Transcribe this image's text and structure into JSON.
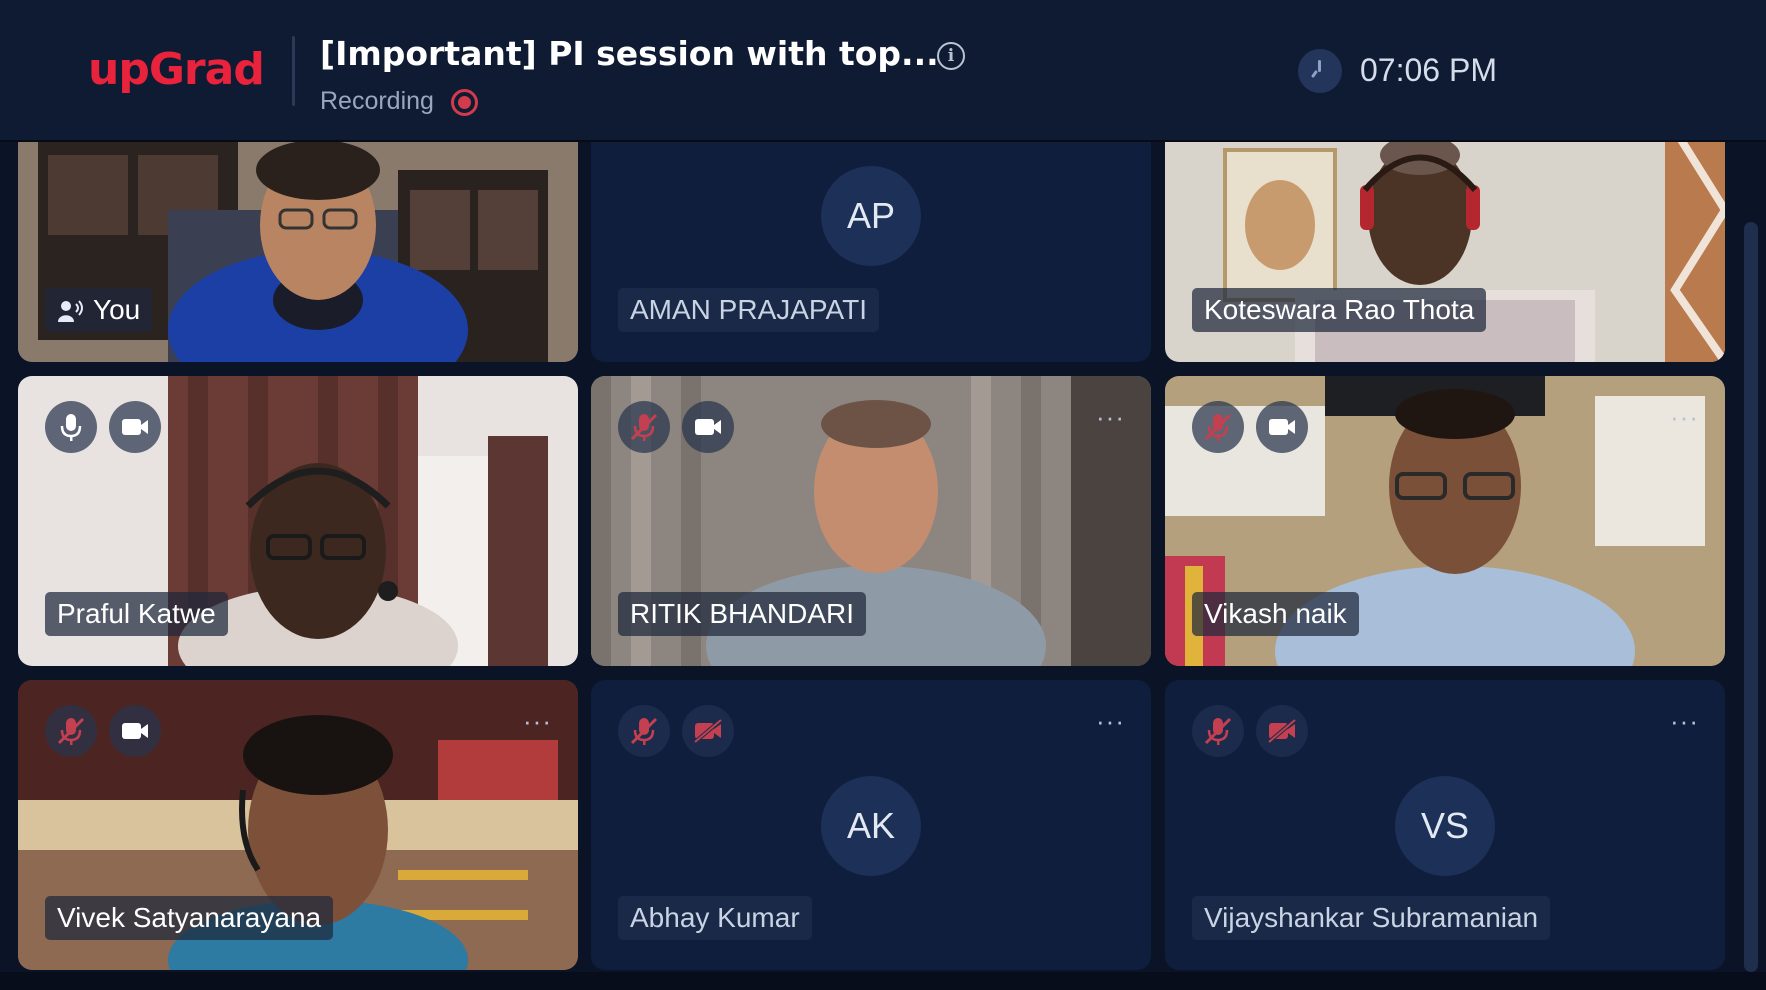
{
  "header": {
    "logo": "upGrad",
    "title": "[Important] PI session with top...",
    "recording_label": "Recording",
    "clock_time": "07:06 PM",
    "icons": [
      "info-icon",
      "recording-icon",
      "clock-icon"
    ]
  },
  "participants": [
    {
      "name": "You",
      "initials": "",
      "video": true,
      "mic": null,
      "cam": null,
      "speaking": true
    },
    {
      "name": "AMAN PRAJAPATI",
      "initials": "AP",
      "video": false
    },
    {
      "name": "Koteswara Rao Thota",
      "initials": "",
      "video": true
    },
    {
      "name": "Praful Katwe",
      "initials": "",
      "video": true,
      "mic": "on",
      "cam": "on"
    },
    {
      "name": "RITIK BHANDARI",
      "initials": "",
      "video": true,
      "mic": "muted",
      "cam": "on"
    },
    {
      "name": "Vikash naik",
      "initials": "",
      "video": true,
      "mic": "muted",
      "cam": "on"
    },
    {
      "name": "Vivek Satyanarayana",
      "initials": "",
      "video": true,
      "mic": "muted",
      "cam": "on"
    },
    {
      "name": "Abhay Kumar",
      "initials": "AK",
      "video": false,
      "mic": "muted",
      "cam": "off"
    },
    {
      "name": "Vijayshankar Subramanian",
      "initials": "VS",
      "video": false,
      "mic": "muted",
      "cam": "off"
    }
  ],
  "more_label": "···",
  "colors": {
    "brand": "#e8233b",
    "header_bg": "#0f1b33",
    "tile_bg": "#0f1e3d",
    "muted_red": "#c2404f"
  }
}
